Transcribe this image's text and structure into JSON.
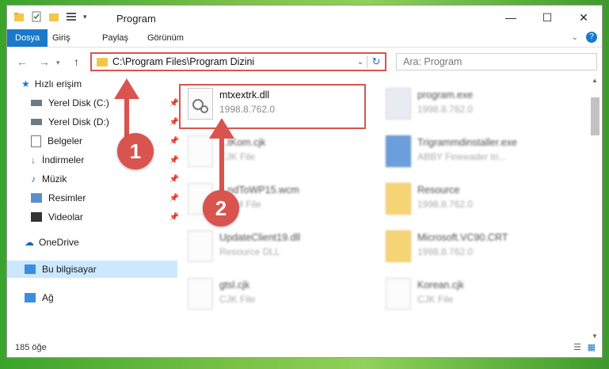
{
  "window": {
    "title": "Program"
  },
  "ribbon": {
    "tabs": [
      "Dosya",
      "Giriş",
      "Paylaş",
      "Görünüm"
    ]
  },
  "address": {
    "path": "C:\\Program Files\\Program Dizini"
  },
  "search": {
    "placeholder": "Ara: Program"
  },
  "sidebar": {
    "quick_access": "Hızlı erişim",
    "items": [
      "Yerel Disk (C:)",
      "Yerel Disk (D:)",
      "Belgeler",
      "İndirmeler",
      "Müzik",
      "Resimler",
      "Videolar"
    ],
    "onedrive": "OneDrive",
    "this_pc": "Bu bilgisayar",
    "network": "Ağ"
  },
  "files_left": [
    {
      "name": "mtxextrk.dll",
      "desc": "1998.8.762.0"
    },
    {
      "name": "...tKom.cjk",
      "desc": "CJK File"
    },
    {
      "name": "...ndToWP15.wcm",
      "desc": "WCM File"
    },
    {
      "name": "UpdateClient19.dll",
      "desc": "Resource DLL"
    },
    {
      "name": "gtsl.cjk",
      "desc": "CJK File"
    }
  ],
  "files_right": [
    {
      "name": "program.exe",
      "desc": "1998.8.762.0"
    },
    {
      "name": "Trigrammdinstaller.exe",
      "desc": "ABBY Fineeader tri..."
    },
    {
      "name": "Resource",
      "desc": "1998.8.762.0"
    },
    {
      "name": "Microsoft.VC90.CRT",
      "desc": "1998.8.762.0"
    },
    {
      "name": "Korean.cjk",
      "desc": "CJK File"
    }
  ],
  "status": {
    "count": "185 öğe"
  },
  "markers": [
    "1",
    "2"
  ],
  "colors": {
    "accent": "#1979ca",
    "highlight": "#d9534f",
    "selection": "#cce8ff"
  }
}
